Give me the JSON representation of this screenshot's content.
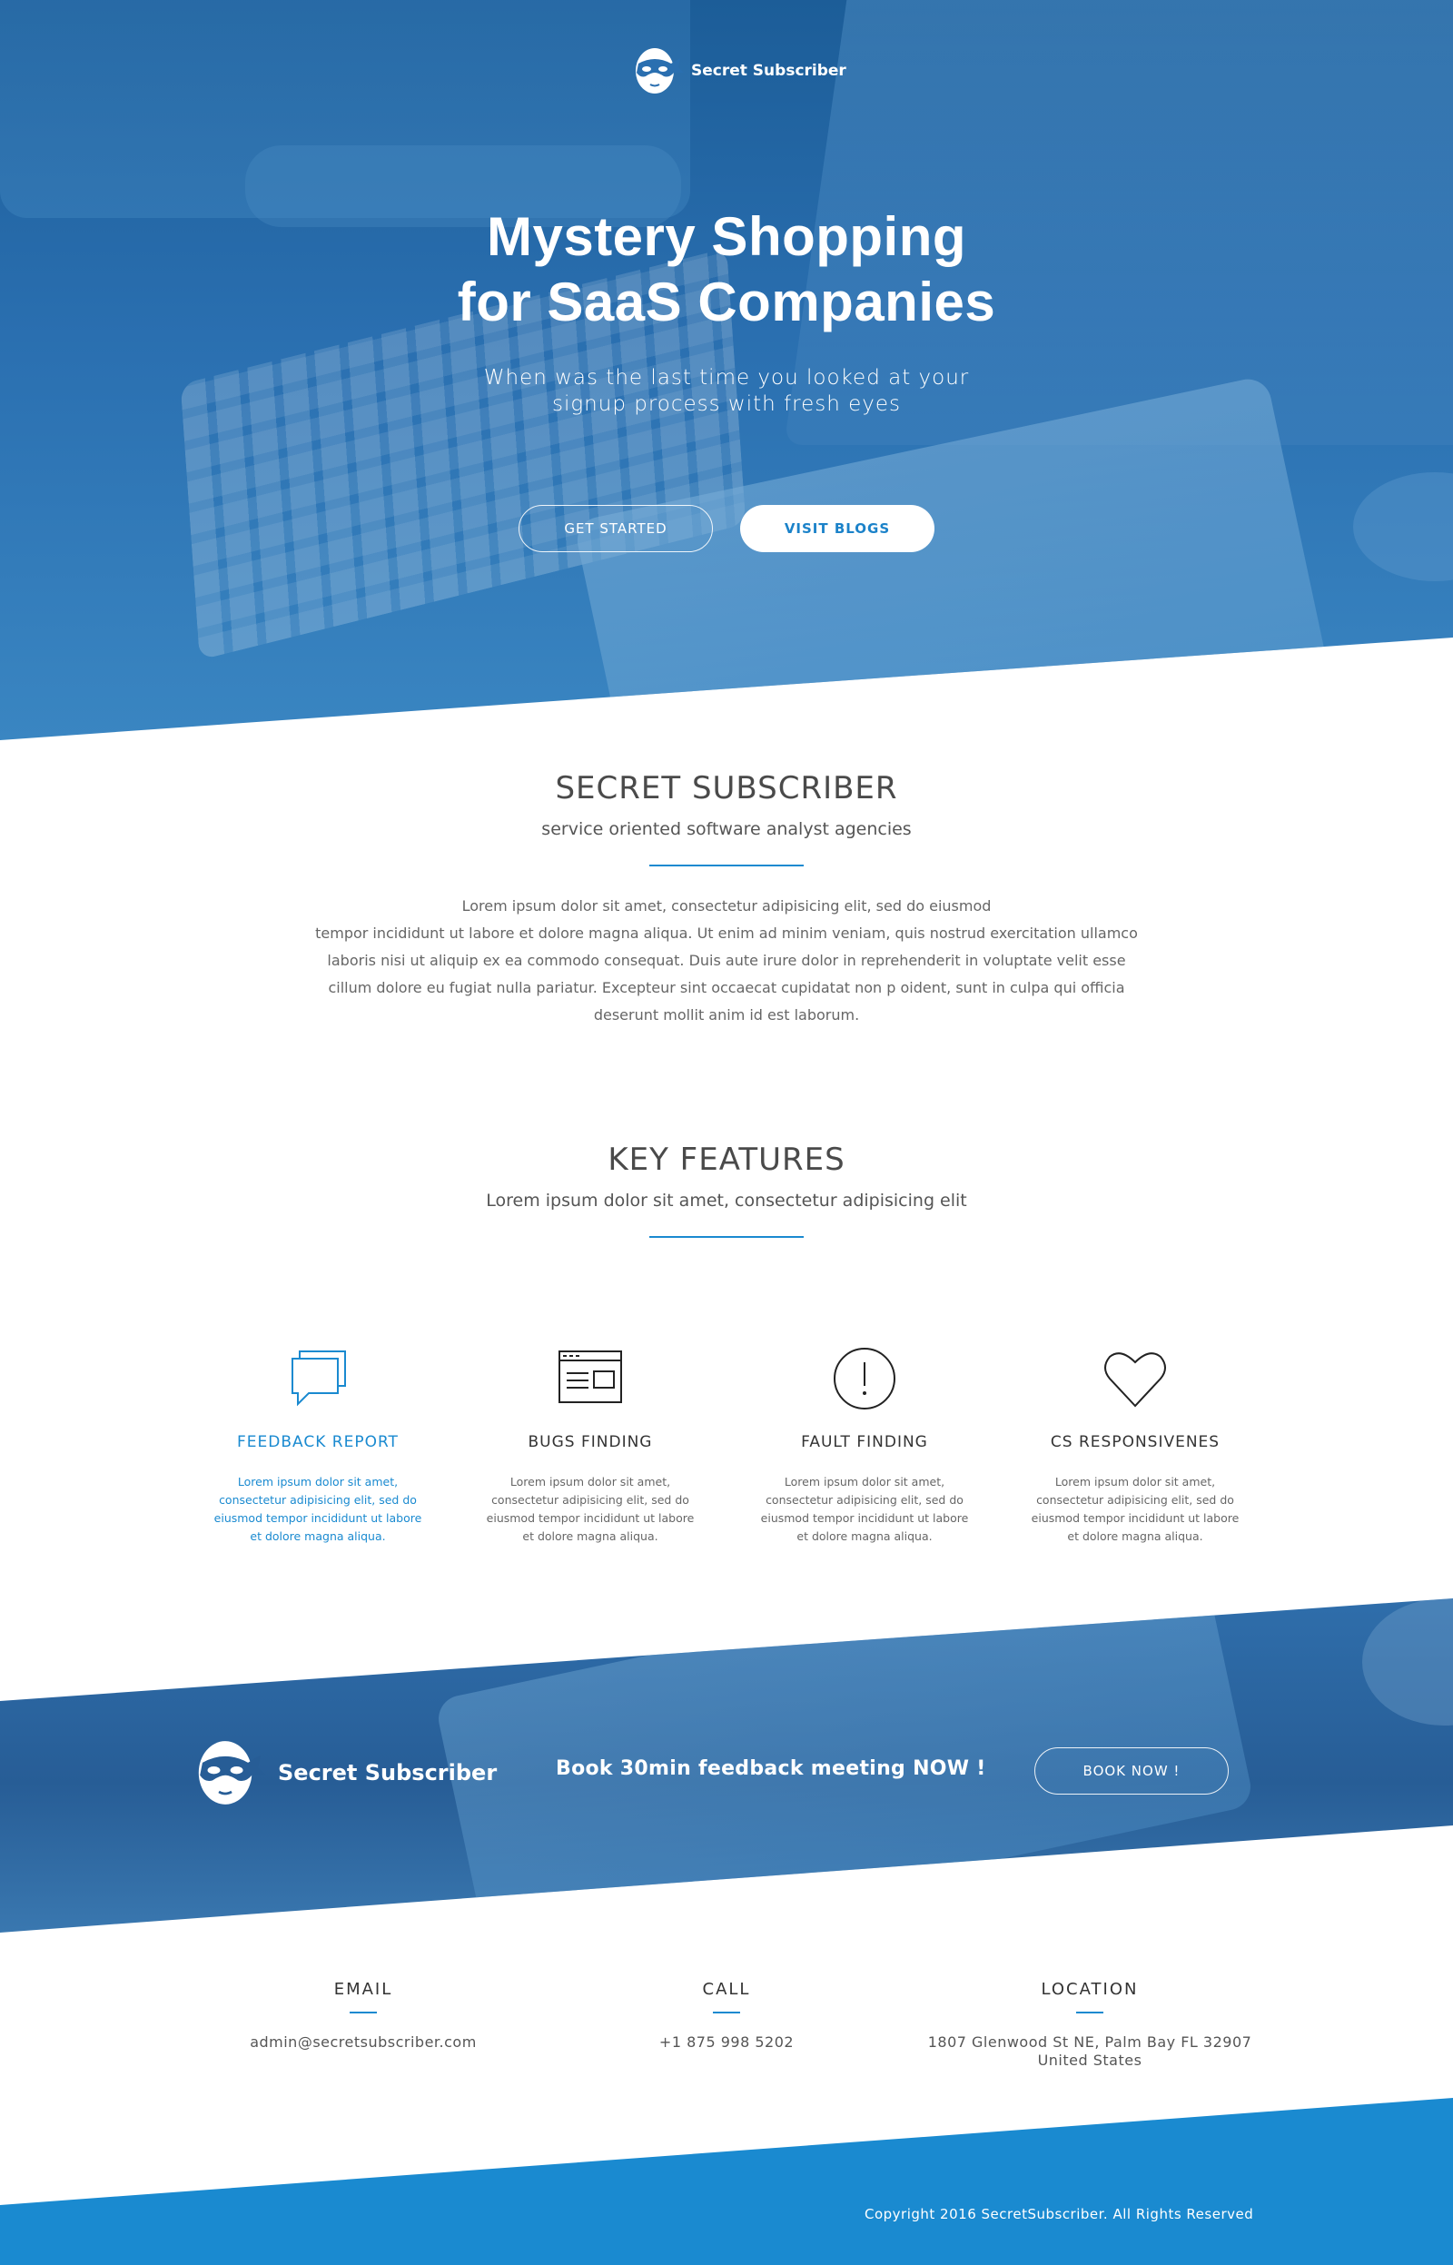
{
  "brand": {
    "name": "Secret Subscriber"
  },
  "hero": {
    "title_line1": "Mystery Shopping",
    "title_line2": "for SaaS Companies",
    "subtitle_line1": "When was the last time you looked at your",
    "subtitle_line2": "signup process with fresh eyes",
    "primary_button": "GET STARTED",
    "secondary_button": "VISIT BLOGS"
  },
  "about": {
    "title": "SECRET SUBSCRIBER",
    "subtitle": "service oriented software analyst agencies",
    "body": [
      "Lorem ipsum dolor sit amet, consectetur adipisicing elit, sed do eiusmod",
      "tempor incididunt ut labore et dolore magna aliqua. Ut enim ad minim veniam, quis nostrud exercitation ullamco",
      "laboris nisi ut aliquip ex ea commodo consequat. Duis aute irure dolor in reprehenderit in voluptate velit esse",
      "cillum dolore eu fugiat nulla pariatur. Excepteur sint occaecat cupidatat non p oident, sunt in culpa qui officia",
      "deserunt mollit anim id est laborum."
    ]
  },
  "features": {
    "title": "KEY FEATURES",
    "subtitle": "Lorem ipsum dolor sit amet, consectetur adipisicing elit",
    "items": [
      {
        "icon": "chat-bubbles-icon",
        "title": "FEEDBACK REPORT",
        "description": "Lorem ipsum dolor sit amet, consectetur adipisicing elit, sed do eiusmod tempor incididunt ut labore et dolore magna aliqua."
      },
      {
        "icon": "browser-window-icon",
        "title": "BUGS FINDING",
        "description": "Lorem ipsum dolor sit amet, consectetur adipisicing elit, sed do eiusmod tempor incididunt ut labore et dolore magna aliqua."
      },
      {
        "icon": "exclamation-circle-icon",
        "title": "FAULT FINDING",
        "description": "Lorem ipsum dolor sit amet, consectetur adipisicing elit, sed do eiusmod tempor incididunt ut labore et dolore magna aliqua."
      },
      {
        "icon": "heart-icon",
        "title": "CS RESPONSIVENES",
        "description": "Lorem ipsum dolor sit amet, consectetur adipisicing elit, sed do eiusmod tempor incididunt ut labore et dolore magna aliqua."
      }
    ]
  },
  "cta": {
    "text": "Book 30min feedback meeting NOW !",
    "button": "BOOK NOW !"
  },
  "contact": {
    "email": {
      "label": "EMAIL",
      "value": "admin@secretsubscriber.com"
    },
    "call": {
      "label": "CALL",
      "value": "+1 875 998 5202"
    },
    "location": {
      "label": "LOCATION",
      "line1": "1807 Glenwood St NE, Palm Bay FL 32907",
      "line2": "United States"
    }
  },
  "footer": {
    "copyright": "Copyright 2016 SecretSubscriber. All Rights Reserved"
  },
  "colors": {
    "accent": "#1a8ad0",
    "hero_blue": "#2a6fb0",
    "text_dark": "#4a4a4a"
  }
}
